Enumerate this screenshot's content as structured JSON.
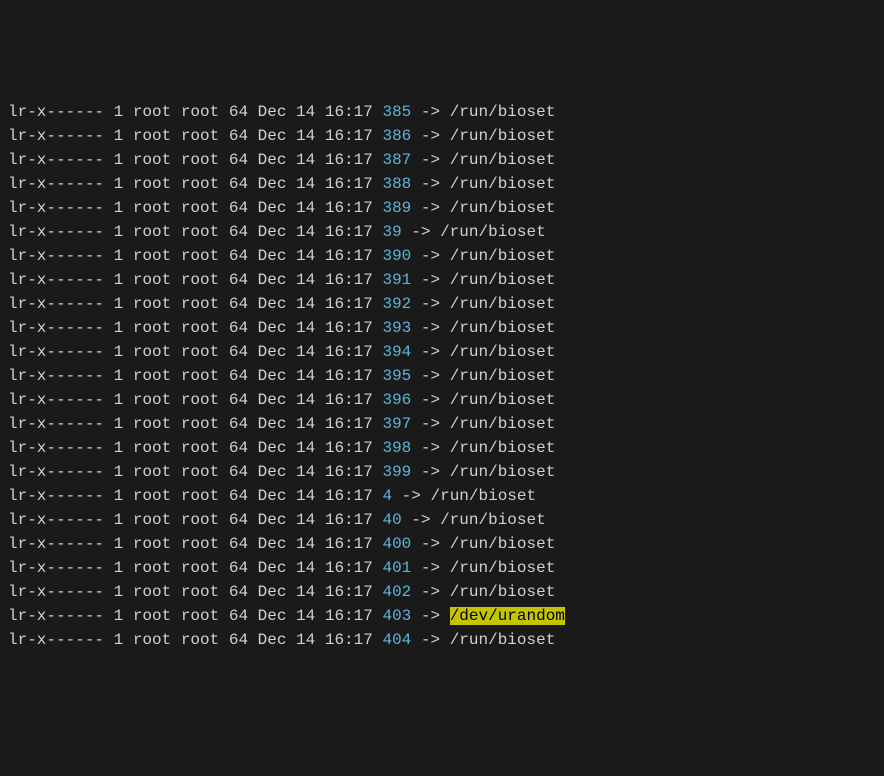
{
  "listing": {
    "prefix": "lr-x------ 1 root root 64 Dec 14 16:17 ",
    "arrow": " -> ",
    "default_target": "/run/bioset",
    "rows": [
      {
        "fd": "385",
        "target": "/run/bioset",
        "highlight": false
      },
      {
        "fd": "386",
        "target": "/run/bioset",
        "highlight": false
      },
      {
        "fd": "387",
        "target": "/run/bioset",
        "highlight": false
      },
      {
        "fd": "388",
        "target": "/run/bioset",
        "highlight": false
      },
      {
        "fd": "389",
        "target": "/run/bioset",
        "highlight": false
      },
      {
        "fd": "39",
        "target": "/run/bioset",
        "highlight": false
      },
      {
        "fd": "390",
        "target": "/run/bioset",
        "highlight": false
      },
      {
        "fd": "391",
        "target": "/run/bioset",
        "highlight": false
      },
      {
        "fd": "392",
        "target": "/run/bioset",
        "highlight": false
      },
      {
        "fd": "393",
        "target": "/run/bioset",
        "highlight": false
      },
      {
        "fd": "394",
        "target": "/run/bioset",
        "highlight": false
      },
      {
        "fd": "395",
        "target": "/run/bioset",
        "highlight": false
      },
      {
        "fd": "396",
        "target": "/run/bioset",
        "highlight": false
      },
      {
        "fd": "397",
        "target": "/run/bioset",
        "highlight": false
      },
      {
        "fd": "398",
        "target": "/run/bioset",
        "highlight": false
      },
      {
        "fd": "399",
        "target": "/run/bioset",
        "highlight": false
      },
      {
        "fd": "4",
        "target": "/run/bioset",
        "highlight": false
      },
      {
        "fd": "40",
        "target": "/run/bioset",
        "highlight": false
      },
      {
        "fd": "400",
        "target": "/run/bioset",
        "highlight": false
      },
      {
        "fd": "401",
        "target": "/run/bioset",
        "highlight": false
      },
      {
        "fd": "402",
        "target": "/run/bioset",
        "highlight": false
      },
      {
        "fd": "403",
        "target": "/dev/urandom",
        "highlight": true
      },
      {
        "fd": "404",
        "target": "/run/bioset",
        "highlight": false
      }
    ]
  }
}
